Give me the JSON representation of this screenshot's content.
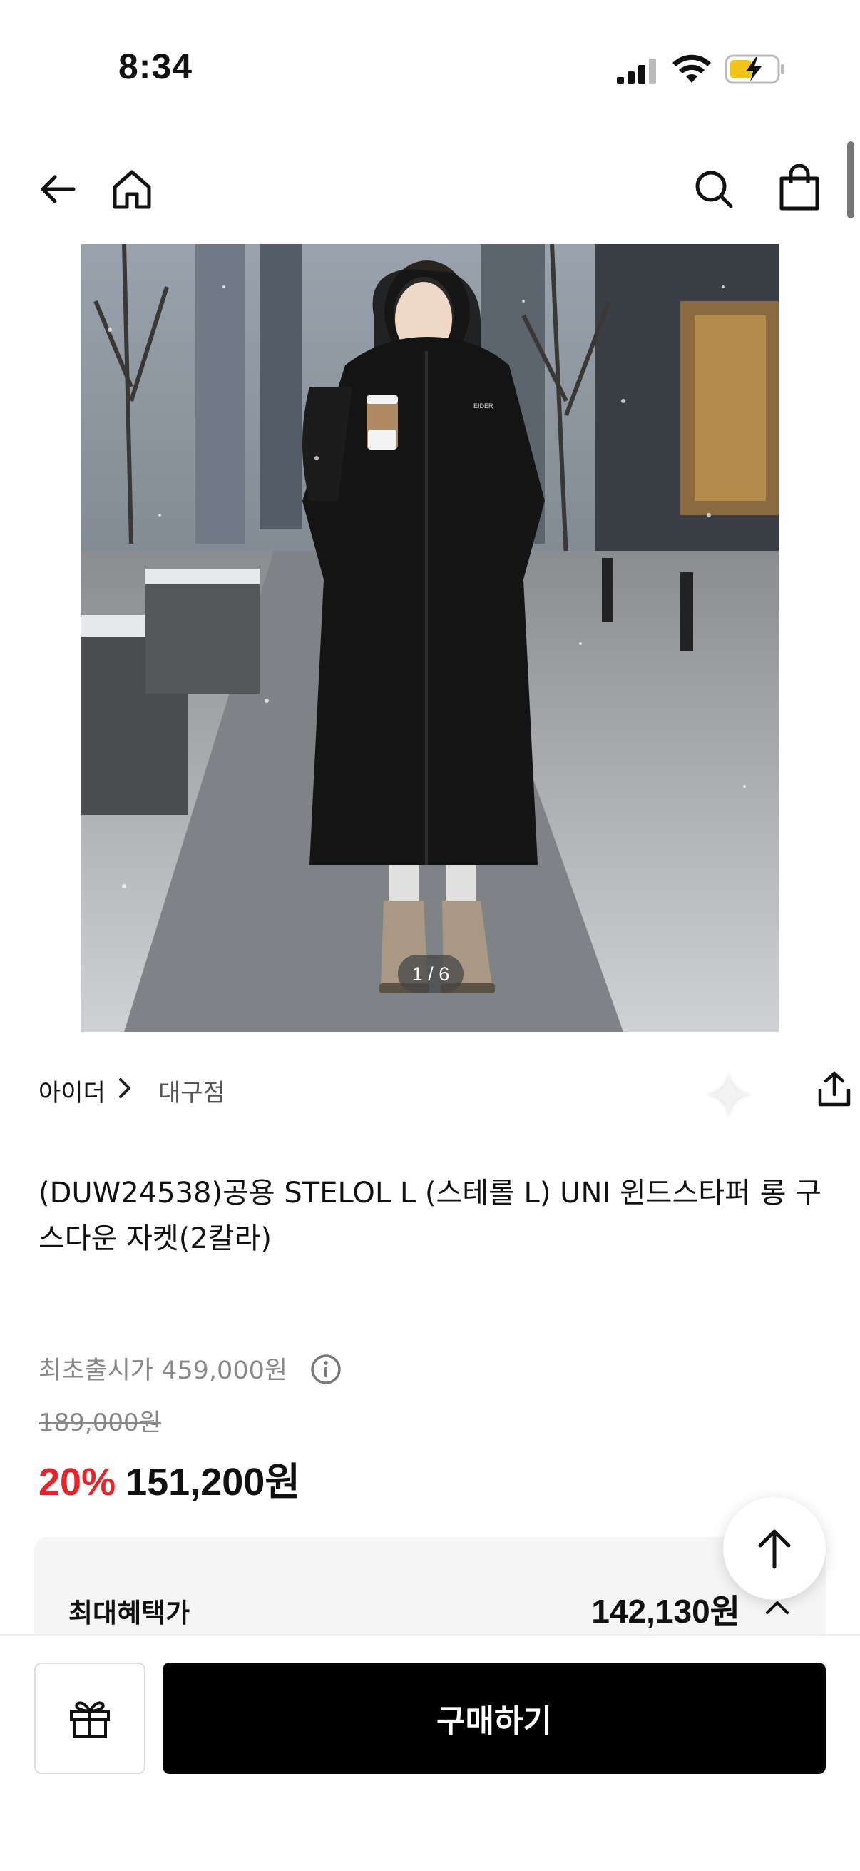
{
  "status_bar": {
    "time": "8:34"
  },
  "gallery": {
    "current": "1",
    "total": "6",
    "counter_text": "1 / 6"
  },
  "brand": {
    "name": "아이더",
    "store": "대구점"
  },
  "product": {
    "title": "(DUW24538)공용 STELOL L (스테롤 L) UNI 윈드스타퍼 롱 구스다운 자켓(2칼라)"
  },
  "price": {
    "launch_price_text": "최초출시가 459,000원",
    "original_price": "189,000원",
    "discount_rate": "20%",
    "sale_price": "151,200원"
  },
  "benefit": {
    "label": "최대혜택가",
    "value": "142,130원"
  },
  "bottom_bar": {
    "buy_label": "구매하기"
  },
  "colors": {
    "discount": "#e8232a",
    "buy_button_bg": "#000000",
    "benefit_bg": "#f5f5f5"
  },
  "icons": [
    "back-icon",
    "home-icon",
    "search-icon",
    "shopping-bag-icon",
    "chevron-right-icon",
    "ai-sparkle-icon",
    "share-icon",
    "info-icon",
    "arrow-up-icon",
    "chevron-up-icon",
    "gift-icon"
  ]
}
